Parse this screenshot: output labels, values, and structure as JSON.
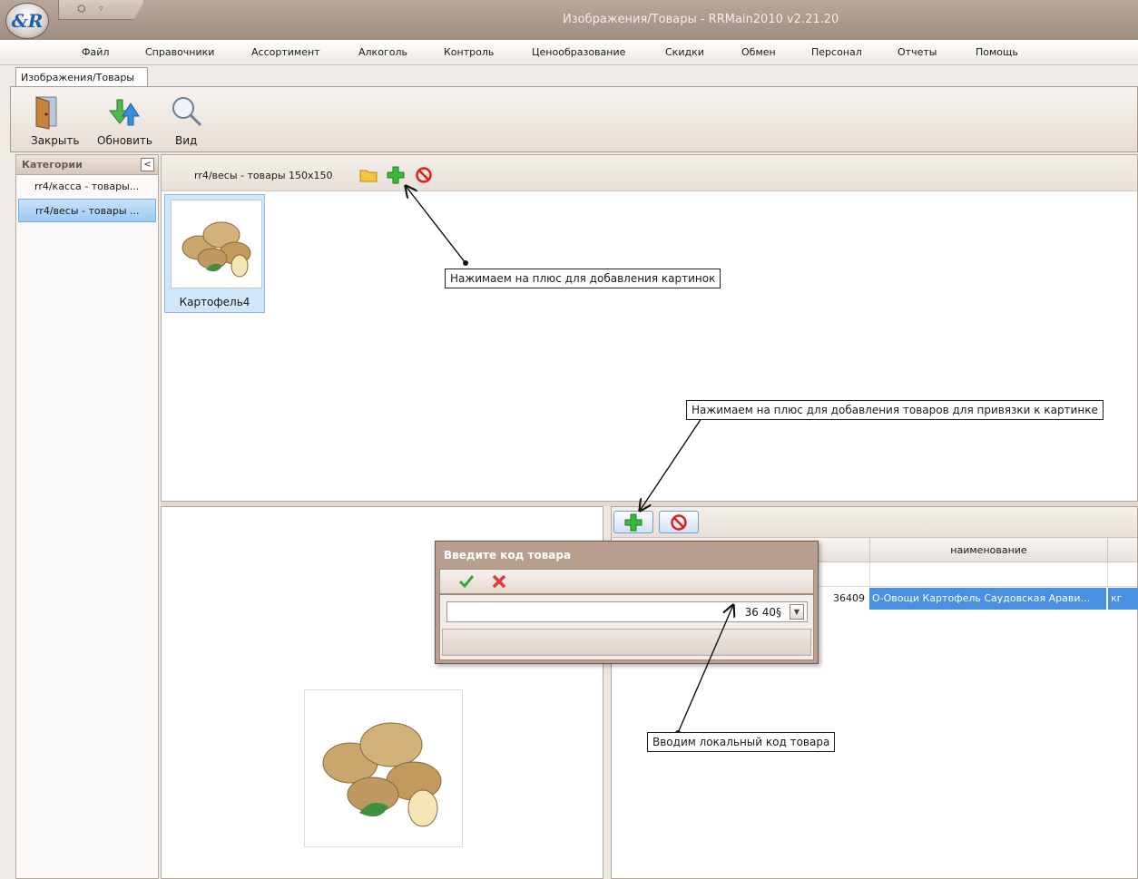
{
  "window": {
    "title": "Изображения/Товары - RRMain2010 v2.21.20",
    "logo_text": "&R"
  },
  "menu": [
    "Файл",
    "Справочники",
    "Ассортимент",
    "Алкоголь",
    "Контроль",
    "Ценообразование",
    "Скидки",
    "Обмен",
    "Персонал",
    "Отчеты",
    "Помощь"
  ],
  "tab": {
    "label": "Изображения/Товары"
  },
  "ribbon": {
    "close_label": "Закрыть",
    "refresh_label": "Обновить",
    "view_label": "Вид"
  },
  "sidebar": {
    "header": "Категории",
    "collapse_glyph": "<",
    "items": [
      {
        "label": "rr4/касса - товары..."
      },
      {
        "label": "rr4/весы - товары ..."
      }
    ]
  },
  "content": {
    "category_name": "rr4/весы - товары 150x150",
    "tile_caption": "Картофель4"
  },
  "grid": {
    "headers": [
      "наименование"
    ],
    "row": {
      "code": "36409",
      "name": "О-Овощи Картофель Саудовская Арави...",
      "unit": "кг"
    }
  },
  "dialog": {
    "title": "Введите код товара",
    "value": "36 40§"
  },
  "callouts": {
    "add_image": "Нажимаем на плюс для добавления картинок",
    "add_goods": "Нажимаем на плюс для добавления товаров для привязки к картинке",
    "enter_code": "Вводим локальный код товара"
  },
  "colors": {
    "accent": "#4a90e2",
    "titlebar": "#a8968a",
    "plus": "#2aa52a",
    "cancel": "#e0201a"
  }
}
